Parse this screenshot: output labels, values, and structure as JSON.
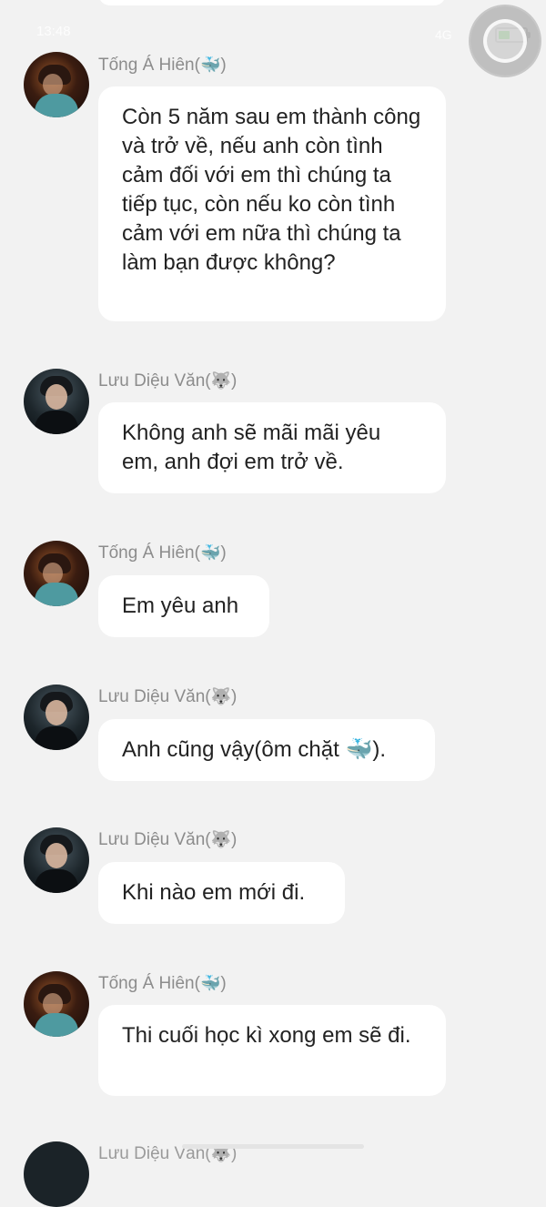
{
  "status_bar": {
    "time": "13:48",
    "right_text": "4G"
  },
  "messages": [
    {
      "sender": "Tống Á Hiên",
      "sender_emoji": "🐳",
      "avatar": "avatar-song-a-hien",
      "text": "Còn 5 năm sau em thành công và trở về, nếu anh còn tình cảm đối với em thì chúng ta tiếp tục, còn nếu ko còn tình cảm với em nữa thì chúng ta làm bạn được không?"
    },
    {
      "sender": "Lưu Diệu Văn",
      "sender_emoji": "🐺",
      "avatar": "avatar-luu-dieu-van",
      "text": "Không anh sẽ mãi mãi yêu em, anh đợi em trở về."
    },
    {
      "sender": "Tống Á Hiên",
      "sender_emoji": "🐳",
      "avatar": "avatar-song-a-hien",
      "text": "Em yêu anh"
    },
    {
      "sender": "Lưu Diệu Văn",
      "sender_emoji": "🐺",
      "avatar": "avatar-luu-dieu-van",
      "text": "Anh cũng vậy(ôm chặt 🐳)."
    },
    {
      "sender": "Lưu Diệu Văn",
      "sender_emoji": "🐺",
      "avatar": "avatar-luu-dieu-van",
      "text": "Khi nào em mới đi."
    },
    {
      "sender": "Tống Á Hiên",
      "sender_emoji": "🐳",
      "avatar": "avatar-song-a-hien",
      "text": "Thi cuối học kì xong em sẽ đi."
    }
  ],
  "partial_message": {
    "sender": "Lưu Diệu Văn",
    "sender_emoji": "🐺"
  },
  "colors": {
    "background": "#f2f2f2",
    "bubble": "#ffffff",
    "sender_name": "#8c8c8c",
    "message_text": "#222222"
  }
}
